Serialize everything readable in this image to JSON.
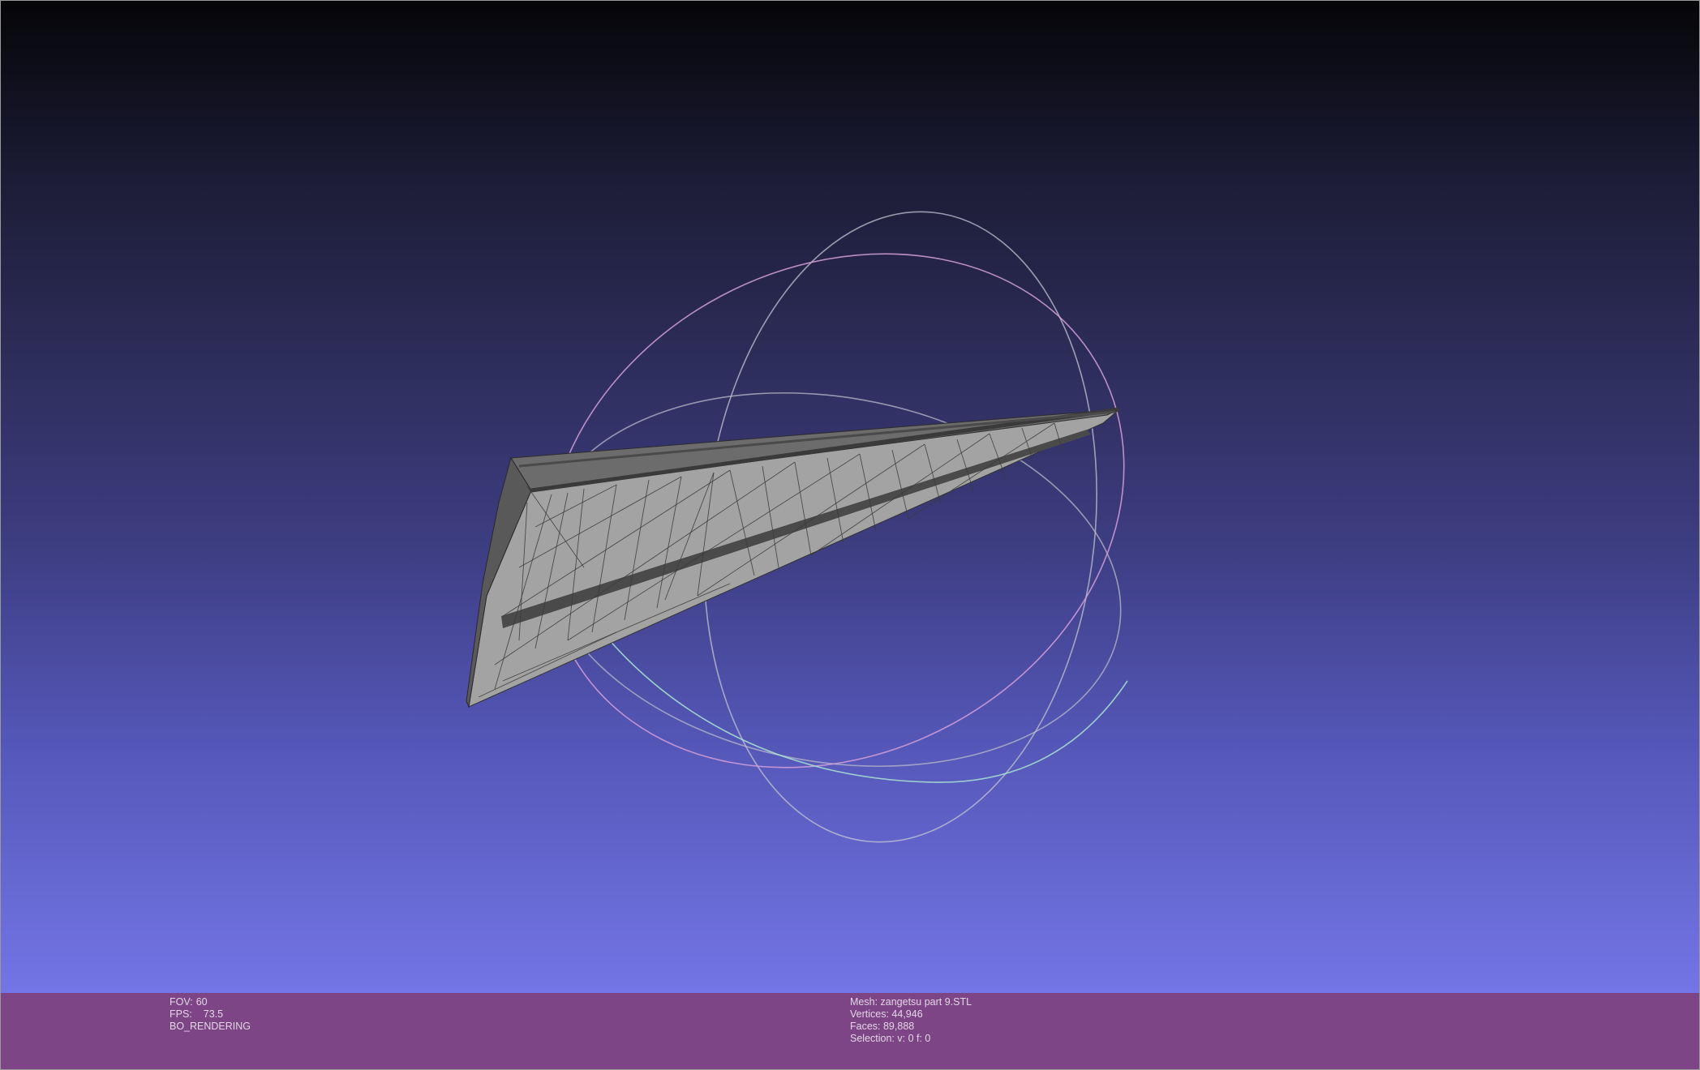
{
  "viewport": {
    "background_top": "#050508",
    "background_bottom": "#7475e6",
    "mesh_color": "#9a9a9a",
    "wire_color": "#3a3a3a",
    "trackball": {
      "ring_x_color": "#c0c0c0",
      "ring_y_color": "#d6a0d8",
      "ring_z_color": "#a8e8d0"
    }
  },
  "status_left": {
    "fov_label": "FOV:",
    "fov_value": "60",
    "fps_label": "FPS:",
    "fps_value": "73.5",
    "render_mode": "BO_RENDERING"
  },
  "status_right": {
    "mesh": "Mesh: zangetsu part 9.STL",
    "vertices": "Vertices: 44,946",
    "faces": "Faces: 89,888",
    "selection": "Selection: v: 0 f: 0"
  },
  "statusbar_color": "#7d4585"
}
